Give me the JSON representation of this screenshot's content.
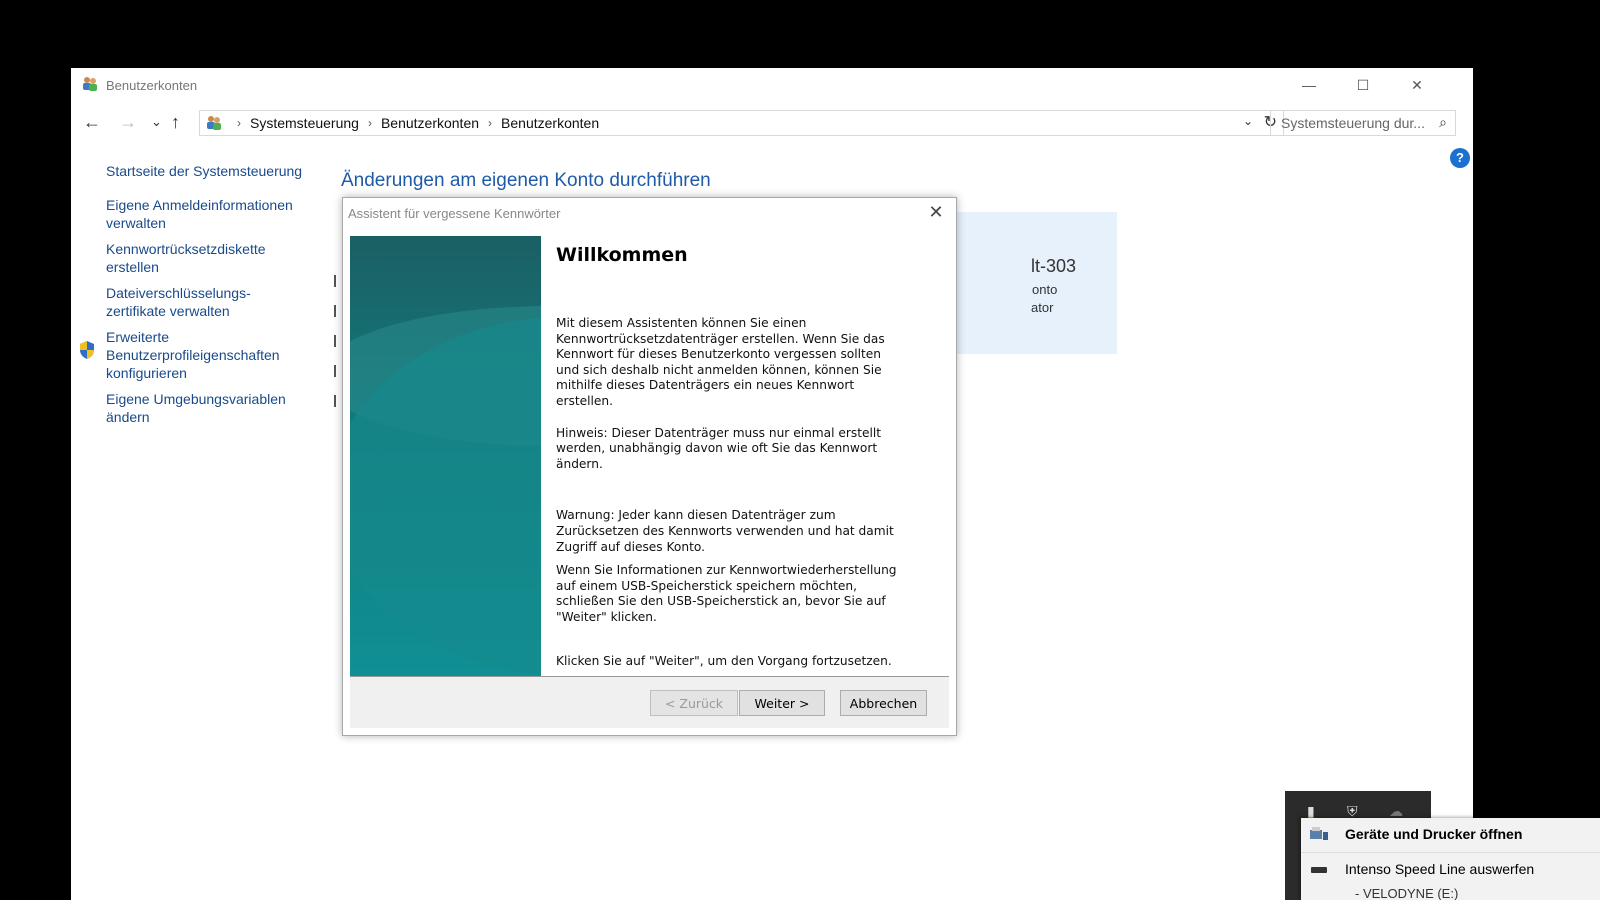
{
  "window": {
    "title": "Benutzerkonten",
    "minimize_label": "—",
    "maximize_label": "☐",
    "close_label": "✕"
  },
  "nav": {
    "back": "←",
    "forward": "→",
    "history": "⌄",
    "up": "↑",
    "breadcrumb": [
      "Systemsteuerung",
      "Benutzerkonten",
      "Benutzerkonten"
    ],
    "breadcrumb_sep": "›",
    "dropdown": "⌄",
    "refresh": "↻",
    "search_placeholder": "Systemsteuerung dur...",
    "search_icon": "⌕"
  },
  "help_label": "?",
  "sidebar": {
    "home": "Startseite der Systemsteuerung",
    "items": [
      "Eigene Anmeldeinformationen verwalten",
      "Kennwortrücksetzdiskette erstellen",
      "Dateiverschlüsselungs-zertifikate verwalten",
      "Erweiterte Benutzerprofileigenschaften konfigurieren",
      "Eigene Umgebungsvariablen ändern"
    ]
  },
  "main": {
    "heading": "Änderungen am eigenen Konto durchführen",
    "account_name_fragment": "lt-303",
    "account_type_fragment": "onto",
    "account_role_fragment": "ator"
  },
  "dialog": {
    "title": "Assistent für vergessene Kennwörter",
    "close": "✕",
    "welcome": "Willkommen",
    "p1": "Mit diesem Assistenten können Sie einen Kennwortrücksetzdatenträger erstellen. Wenn Sie das Kennwort für dieses Benutzerkonto vergessen sollten und sich deshalb nicht anmelden können, können Sie mithilfe dieses Datenträgers ein neues Kennwort erstellen.",
    "p2": "Hinweis: Dieser Datenträger muss nur einmal erstellt werden, unabhängig davon wie oft Sie das Kennwort ändern.",
    "p3": "Warnung: Jeder kann diesen Datenträger zum Zurücksetzen des Kennworts verwenden und hat damit Zugriff auf dieses Konto.",
    "p4": "Wenn Sie Informationen zur Kennwortwiederherstellung auf einem USB-Speicherstick speichern möchten, schließen Sie den USB-Speicherstick an, bevor Sie auf \"Weiter\" klicken.",
    "p5": "Klicken Sie auf \"Weiter\", um den Vorgang fortzusetzen.",
    "back_button": "< Zurück",
    "next_button": "Weiter >",
    "cancel_button": "Abbrechen"
  },
  "tray": {
    "open_devices": "Geräte und Drucker öffnen",
    "eject": "Intenso Speed Line auswerfen",
    "volume": "-   VELODYNE (E:)"
  }
}
